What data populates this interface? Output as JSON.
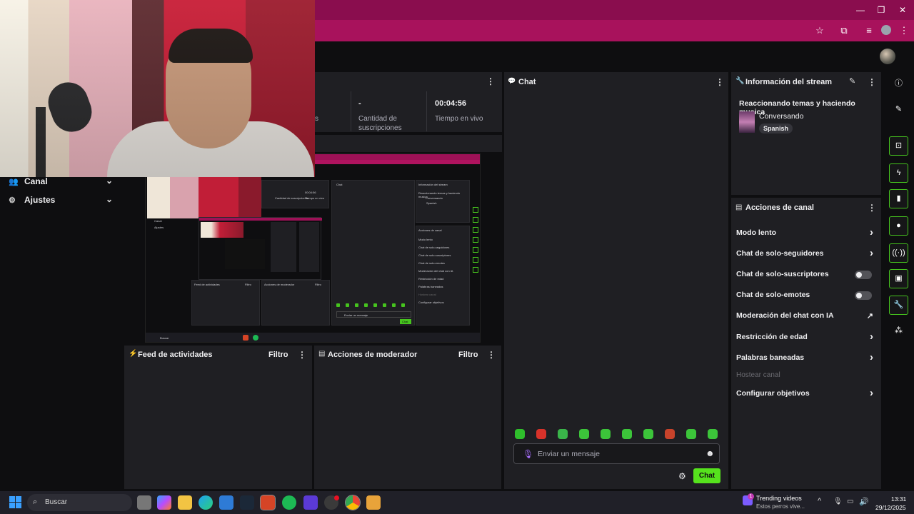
{
  "browser": {
    "colors": {
      "title_bar": "#8a0d4e",
      "address_bar": "#a8125c"
    },
    "icons": [
      "star-icon",
      "extensions-icon",
      "media-icon",
      "profile-icon",
      "menu-icon"
    ]
  },
  "stats": {
    "dash": "-",
    "subs_label_1": "Cantidad de",
    "subs_label_2": "suscripciones",
    "time_value": "00:04:56",
    "time_label": "Tiempo en vivo",
    "cut_label": "s"
  },
  "sidebar": {
    "items": [
      {
        "label": "Canal"
      },
      {
        "label": "Ajustes"
      }
    ]
  },
  "feed": {
    "title": "Feed de actividades",
    "filter": "Filtro"
  },
  "mod_actions": {
    "title": "Acciones de moderador",
    "filter": "Filtro"
  },
  "chat": {
    "title": "Chat",
    "placeholder": "Enviar un mensaje",
    "send_label": "Chat",
    "emote_colors": [
      "#2fbf2c",
      "#d8322a",
      "#3ab54a",
      "#3cc43a",
      "#3cc43a",
      "#3cc43a",
      "#3cc43a",
      "#c8432b",
      "#3cc43a",
      "#3cc43a"
    ]
  },
  "info": {
    "title": "Información del stream",
    "stream_title": "Reaccionando temas y haciendo musica",
    "category": "Conversando",
    "language": "Spanish"
  },
  "acciones": {
    "title": "Acciones de canal",
    "items": [
      {
        "label": "Modo lento"
      },
      {
        "label": "Chat de solo-seguidores"
      },
      {
        "label": "Chat de solo-suscriptores"
      },
      {
        "label": "Chat de solo-emotes"
      },
      {
        "label": "Moderación del chat con IA"
      },
      {
        "label": "Restricción de edad"
      },
      {
        "label": "Palabras baneadas"
      },
      {
        "label": "Hostear canal"
      },
      {
        "label": "Configurar objetivos"
      }
    ]
  },
  "preview": {
    "stream_info": "Información del stream",
    "stream_title": "Reaccionando temas y haciendo musica",
    "category": "Conversando",
    "language": "Spanish",
    "chat": "Chat",
    "actions": "Acciones de canal",
    "feed": "Feed de actividades",
    "mod": "Acciones de moderador",
    "filter": "Filtro",
    "send": "Enviar un mensaje",
    "time": "00:04:56",
    "time_label": "Tiempo en vivo",
    "subs_label": "Cantidad de suscripciones",
    "canal": "Canal",
    "ajustes": "Ajustes",
    "search": "Buscar",
    "chat_btn": "Chat",
    "items": [
      "Modo lento",
      "Chat de solo-seguidores",
      "Chat de solo-suscriptores",
      "Chat de solo-emotes",
      "Moderación del chat con IA",
      "Restricción de edad",
      "Palabras baneadas",
      "Hostear canal",
      "Configurar objetivos"
    ]
  },
  "taskbar": {
    "search": "Buscar",
    "news_title": "Trending videos",
    "news_sub": "Estos perros vive...",
    "news_badge": "1",
    "time": "13:31",
    "date": "29/12/2025"
  }
}
